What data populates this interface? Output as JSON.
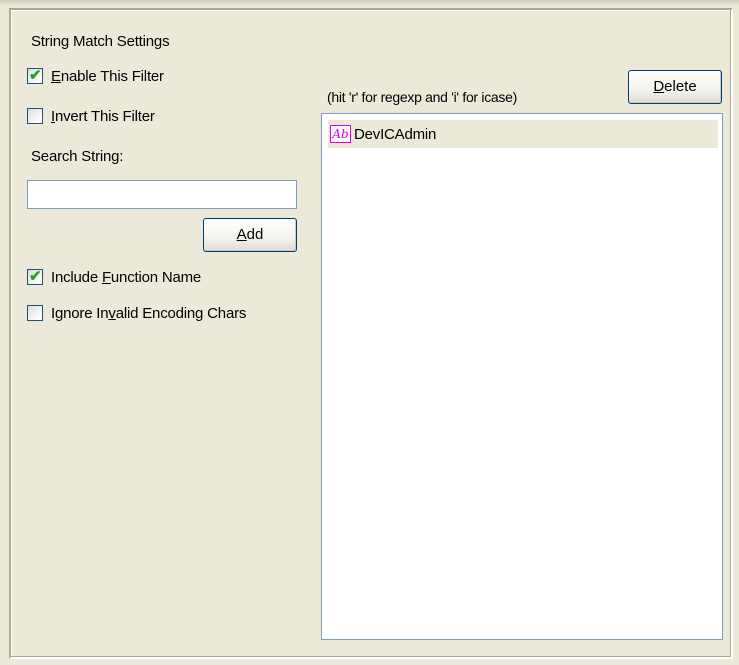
{
  "group": {
    "title": "String Match Settings"
  },
  "checkboxes": {
    "enable_filter": {
      "label_prefix": "",
      "mnemonic": "E",
      "label_rest": "nable This Filter",
      "checked": true
    },
    "invert_filter": {
      "label_prefix": "",
      "mnemonic": "I",
      "label_rest": "nvert This Filter",
      "checked": false
    },
    "include_function_name": {
      "label_prefix": "Include ",
      "mnemonic": "F",
      "label_rest": "unction Name",
      "checked": true
    },
    "ignore_invalid_encoding": {
      "label_prefix": "Ignore In",
      "mnemonic": "v",
      "label_rest": "alid Encoding Chars",
      "checked": false
    }
  },
  "search": {
    "label": "Search String:",
    "value": "",
    "placeholder": ""
  },
  "buttons": {
    "add": {
      "mnemonic": "A",
      "label_rest": "dd"
    },
    "delete": {
      "mnemonic": "D",
      "label_rest": "elete"
    }
  },
  "hint": "(hit 'r' for regexp and 'i' for icase)",
  "list": {
    "items": [
      {
        "icon": "ab-text-icon",
        "icon_text": "Ab",
        "label": "DevICAdmin"
      }
    ]
  },
  "colors": {
    "background": "#ece9d8",
    "check_mark": "#21a121",
    "ab_icon": "#e000e0",
    "list_selection": "#ece9d8"
  }
}
